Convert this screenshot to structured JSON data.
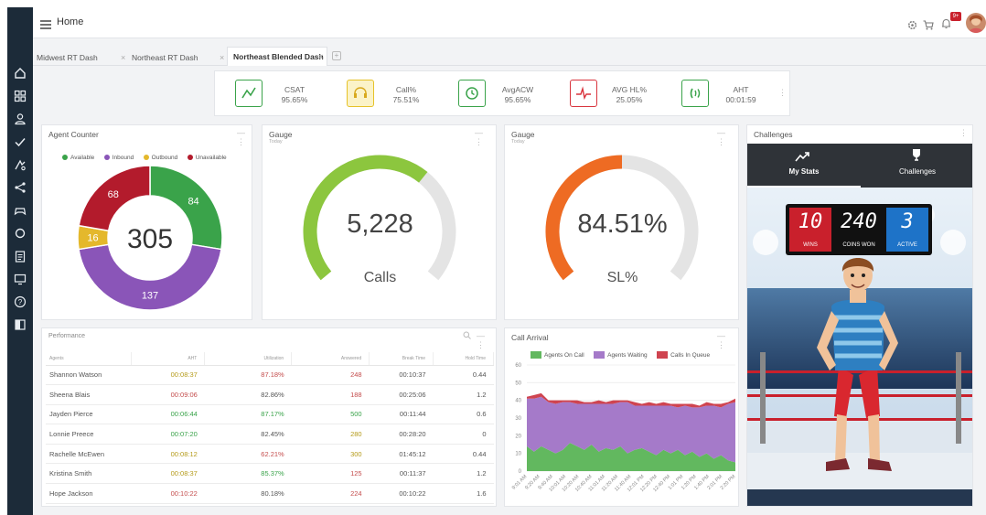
{
  "header": {
    "title": "Home",
    "badge": "9+"
  },
  "tabs": [
    {
      "label": "Midwest RT Dash"
    },
    {
      "label": "Northeast RT Dash"
    },
    {
      "label": "Northeast Blended Dash",
      "active": true
    }
  ],
  "kpis": [
    {
      "label": "CSAT",
      "value": "95.65%",
      "icon": "trend-line-icon",
      "color": "#3aa34a"
    },
    {
      "label": "Call%",
      "value": "75.51%",
      "icon": "headset-icon",
      "color": "#e6c229"
    },
    {
      "label": "AvgACW",
      "value": "95.65%",
      "icon": "phone-clock-icon",
      "color": "#3aa34a"
    },
    {
      "label": "AVG HL%",
      "value": "25.05%",
      "icon": "pulse-icon",
      "color": "#d9343d"
    },
    {
      "label": "AHT",
      "value": "00:01:59",
      "icon": "phone-ring-icon",
      "color": "#3aa34a"
    }
  ],
  "agent_counter": {
    "title": "Agent Counter",
    "total": "305",
    "legend": [
      {
        "label": "Available",
        "color": "#3aa34a"
      },
      {
        "label": "Inbound",
        "color": "#8a55b8"
      },
      {
        "label": "Outbound",
        "color": "#e4b82c"
      },
      {
        "label": "Unavailable",
        "color": "#b31b2c"
      }
    ]
  },
  "gauge_calls": {
    "title": "Gauge",
    "subtitle": "Today",
    "value": "5,228",
    "label": "Calls",
    "fraction": 0.65,
    "color": "#8cc63e"
  },
  "gauge_sl": {
    "title": "Gauge",
    "subtitle": "Today",
    "value": "84.51%",
    "label": "SL%",
    "fraction": 0.5,
    "color": "#ee6b23"
  },
  "challenges": {
    "title": "Challenges",
    "tabs": [
      {
        "label": "My Stats",
        "icon": "trend-up-icon"
      },
      {
        "label": "Challenges",
        "icon": "trophy-icon"
      }
    ],
    "scoreboard": [
      {
        "value": "10",
        "label": "WINS",
        "color": "#c9202c"
      },
      {
        "value": "240",
        "label": "COINS WON",
        "color": "#111111"
      },
      {
        "value": "3",
        "label": "ACTIVE",
        "color": "#1e73c8"
      }
    ]
  },
  "performance": {
    "title": "Performance",
    "columns": [
      "Agents",
      "AHT",
      "Utilization",
      "Answered",
      "Break Time",
      "Hold Time"
    ],
    "rows": [
      {
        "agent": "Shannon Watson",
        "aht": "00:08:37",
        "aht_color": "#b59b1a",
        "util": "87.18%",
        "util_color": "#c44d4d",
        "answered": "248",
        "ans_color": "#c44d4d",
        "break": "00:10:37",
        "hold": "0.44"
      },
      {
        "agent": "Sheena Blais",
        "aht": "00:09:06",
        "aht_color": "#c44d4d",
        "util": "82.86%",
        "util_color": "#555555",
        "answered": "188",
        "ans_color": "#c44d4d",
        "break": "00:25:06",
        "hold": "1.2"
      },
      {
        "agent": "Jayden Pierce",
        "aht": "00:06:44",
        "aht_color": "#3aa34a",
        "util": "87.17%",
        "util_color": "#3aa34a",
        "answered": "500",
        "ans_color": "#3aa34a",
        "break": "00:11:44",
        "hold": "0.6"
      },
      {
        "agent": "Lonnie Preece",
        "aht": "00:07:20",
        "aht_color": "#3aa34a",
        "util": "82.45%",
        "util_color": "#555555",
        "answered": "280",
        "ans_color": "#b59b1a",
        "break": "00:28:20",
        "hold": "0"
      },
      {
        "agent": "Rachelle McEwen",
        "aht": "00:08:12",
        "aht_color": "#b59b1a",
        "util": "62.21%",
        "util_color": "#c44d4d",
        "answered": "300",
        "ans_color": "#b59b1a",
        "break": "01:45:12",
        "hold": "0.44"
      },
      {
        "agent": "Kristina Smith",
        "aht": "00:08:37",
        "aht_color": "#b59b1a",
        "util": "85.37%",
        "util_color": "#3aa34a",
        "answered": "125",
        "ans_color": "#c44d4d",
        "break": "00:11:37",
        "hold": "1.2"
      },
      {
        "agent": "Hope Jackson",
        "aht": "00:10:22",
        "aht_color": "#c44d4d",
        "util": "80.18%",
        "util_color": "#555555",
        "answered": "224",
        "ans_color": "#c44d4d",
        "break": "00:10:22",
        "hold": "1.6"
      }
    ]
  },
  "chart_data": [
    {
      "type": "pie",
      "title": "Agent Counter",
      "categories": [
        "Available",
        "Inbound",
        "Outbound",
        "Unavailable"
      ],
      "values": [
        84,
        137,
        16,
        68
      ],
      "colors": [
        "#3aa34a",
        "#8a55b8",
        "#e4b82c",
        "#b31b2c"
      ],
      "center_label": "305"
    },
    {
      "type": "area",
      "title": "Call Arrival",
      "ylim": [
        0,
        60
      ],
      "yticks": [
        0,
        10,
        20,
        30,
        40,
        50,
        60
      ],
      "x": [
        "9:01 AM",
        "9:20 AM",
        "9:40 AM",
        "10:01 AM",
        "10:20 AM",
        "10:40 AM",
        "11:01 AM",
        "11:20 AM",
        "11:40 AM",
        "12:01 PM",
        "12:20 PM",
        "12:40 PM",
        "1:01 PM",
        "1:20 PM",
        "1:40 PM",
        "2:01 PM",
        "2:20 PM"
      ],
      "series": [
        {
          "name": "Agents On Call",
          "color": "#62b85f",
          "values": [
            14,
            11,
            14,
            12,
            10,
            12,
            16,
            14,
            12,
            15,
            11,
            13,
            12,
            14,
            10,
            12,
            13,
            11,
            9,
            12,
            10,
            12,
            9,
            11,
            8,
            10,
            7,
            9,
            6,
            5
          ]
        },
        {
          "name": "Agents Waiting",
          "color": "#a57ac9",
          "values": [
            27,
            30,
            28,
            27,
            28,
            27,
            23,
            24,
            26,
            23,
            27,
            25,
            26,
            25,
            29,
            25,
            24,
            26,
            28,
            25,
            27,
            24,
            28,
            25,
            28,
            27,
            30,
            27,
            32,
            34
          ]
        },
        {
          "name": "Calls In Queue",
          "color": "#cf4450",
          "values": [
            1,
            2,
            2,
            1,
            2,
            1,
            1,
            2,
            1,
            1,
            2,
            1,
            2,
            1,
            1,
            2,
            1,
            2,
            1,
            2,
            1,
            2,
            1,
            2,
            1,
            2,
            1,
            2,
            1,
            2
          ]
        }
      ]
    }
  ]
}
